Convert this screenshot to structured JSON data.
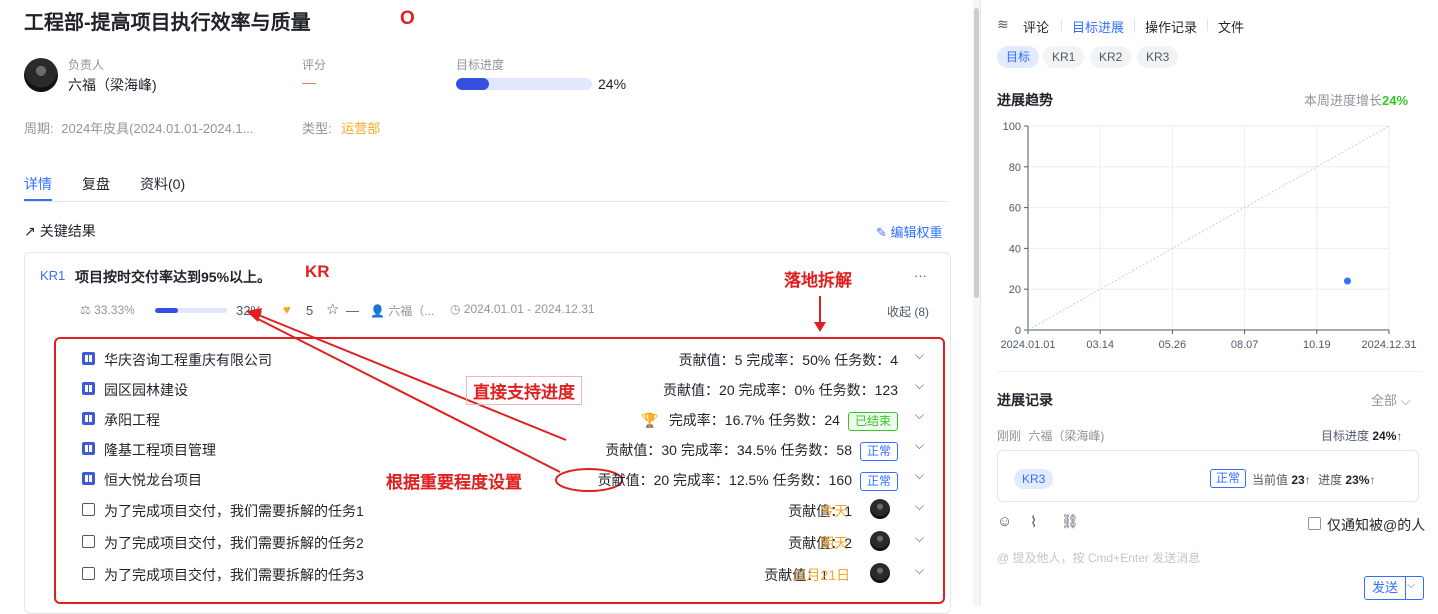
{
  "header": {
    "title": "工程部-提高项目执行效率与质量",
    "annotation": "O"
  },
  "owner": {
    "label": "负责人",
    "name": "六福（梁海峰)"
  },
  "score": {
    "label": "评分",
    "value": "—"
  },
  "goal_progress": {
    "label": "目标进度",
    "percent_text": "24%",
    "percent": 24
  },
  "period": {
    "label": "周期:",
    "value": "2024年皮具(2024.01.01-2024.1..."
  },
  "type": {
    "label": "类型:",
    "value": "运营部"
  },
  "tabs": [
    "详情",
    "复盘",
    "资料(0)"
  ],
  "section": {
    "title": "关键结果",
    "edit_weight": "编辑权重"
  },
  "kr": {
    "tag": "KR1",
    "title": "项目按时交付率达到95%以上。",
    "annotation_kr": "KR",
    "weight": "33.33%",
    "progress_text": "32%",
    "progress": 32,
    "likes": "5",
    "star": "—",
    "owner": "六福（...",
    "dates": "2024.01.01 - 2024.12.31",
    "collapse": "收起 (8)",
    "more": "···"
  },
  "annotations": {
    "breakdown": "落地拆解",
    "direct": "直接支持进度",
    "importance": "根据重要程度设置"
  },
  "rows": [
    {
      "name": "华庆咨询工程重庆有限公司",
      "meta": "贡献值：5   完成率：50%   任务数：4"
    },
    {
      "name": "园区园林建设",
      "meta": "贡献值：20   完成率：0%   任务数：123"
    },
    {
      "name": "承阳工程",
      "meta": "完成率：16.7%   任务数：24",
      "badge": "已结束"
    },
    {
      "name": "隆基工程项目管理",
      "meta": "贡献值：30   完成率：34.5%   任务数：58",
      "badge": "正常"
    },
    {
      "name": "恒大悦龙台项目",
      "meta_a": "贡献值：",
      "meta_b": "20   完成率：12.5%   任务数：160",
      "badge": "正常"
    }
  ],
  "tasks": [
    {
      "name": "为了完成项目交付，我们需要拆解的任务1",
      "contrib": "贡献值：1",
      "due": "今天"
    },
    {
      "name": "为了完成项目交付，我们需要拆解的任务2",
      "contrib": "贡献值：2",
      "due": "明天"
    },
    {
      "name": "为了完成项目交付，我们需要拆解的任务3",
      "contrib": "贡献值：1",
      "due": "11月21日"
    }
  ],
  "right": {
    "tabs": [
      "评论",
      "目标进展",
      "操作记录",
      "文件"
    ],
    "pills": [
      "目标",
      "KR1",
      "KR2",
      "KR3"
    ],
    "trend_title": "进展趋势",
    "weekly_label": "本周进度增长",
    "weekly_value": "24%",
    "records_title": "进展记录",
    "filter": "全部",
    "record": {
      "time": "刚刚",
      "who": "六福（梁海峰)",
      "goal_label": "目标进度",
      "goal_value": "24%",
      "tag": "KR3",
      "status": "正常",
      "current_label": "当前值",
      "current_value": "23",
      "progress_label": "进度",
      "progress_value": "23%"
    },
    "notify": "仅通知被@的人",
    "placeholder": "@ 提及他人，按 Cmd+Enter 发送消息",
    "send": "发送"
  },
  "chart_data": {
    "type": "line",
    "title": "进展趋势",
    "y_ticks": [
      "100",
      "80",
      "60",
      "40",
      "20",
      "0"
    ],
    "x_ticks": [
      "2024.01.01",
      "03.14",
      "05.26",
      "08.07",
      "10.19",
      "2024.12.31"
    ],
    "ylim": [
      0,
      100
    ],
    "xlim": [
      "2024.01.01",
      "2024.12.31"
    ],
    "grid": true,
    "series": [
      {
        "values": [
          {
            "x": "2024.01.01",
            "y": 0
          },
          {
            "x": "2024.12.31",
            "y": 100
          }
        ]
      },
      {
        "values": [
          {
            "x": "2024.11.19",
            "y": 24
          }
        ]
      }
    ]
  },
  "colors": {
    "accent": "#3370ff",
    "annotation": "#e02020",
    "success": "#34c724",
    "warning": "#f5a623"
  }
}
